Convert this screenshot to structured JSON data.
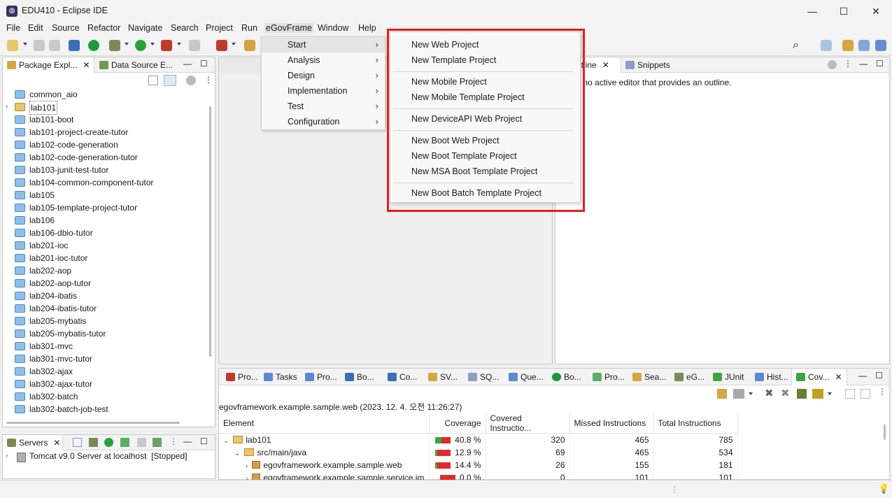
{
  "window": {
    "title": "EDU410 - Eclipse IDE",
    "minimize_icon": "minimize-icon",
    "maximize_icon": "maximize-icon",
    "close_icon": "close-icon"
  },
  "menubar": [
    "File",
    "Edit",
    "Source",
    "Refactor",
    "Navigate",
    "Search",
    "Project",
    "Run",
    "eGovFrame",
    "Window",
    "Help"
  ],
  "egov_menu": {
    "items": [
      "Start",
      "Analysis",
      "Design",
      "Implementation",
      "Test",
      "Configuration"
    ],
    "chevron": "›"
  },
  "start_submenu": {
    "items": [
      "New Web Project",
      "New Template Project",
      "New Mobile Project",
      "New Mobile Template Project",
      "New DeviceAPI Web Project",
      "New Boot Web Project",
      "New Boot Template Project",
      "New MSA Boot Template Project",
      "New Boot Batch Template Project"
    ]
  },
  "left_panel": {
    "tabs": [
      "Package Expl...",
      "Data Source E..."
    ],
    "tree": [
      "common_aio",
      "lab101",
      "lab101-boot",
      "lab101-project-create-tutor",
      "lab102-code-generation",
      "lab102-code-generation-tutor",
      "lab103-junit-test-tutor",
      "lab104-common-component-tutor",
      "lab105",
      "lab105-template-project-tutor",
      "lab106",
      "lab106-dbio-tutor",
      "lab201-ioc",
      "lab201-ioc-tutor",
      "lab202-aop",
      "lab202-aop-tutor",
      "lab204-ibatis",
      "lab204-ibatis-tutor",
      "lab205-mybatis",
      "lab205-mybatis-tutor",
      "lab301-mvc",
      "lab301-mvc-tutor",
      "lab302-ajax",
      "lab302-ajax-tutor",
      "lab302-batch",
      "lab302-batch-job-test"
    ]
  },
  "servers_panel": {
    "tab": "Servers",
    "server": "Tomcat v9.0 Server at localhost",
    "status": "[Stopped]"
  },
  "outline_panel": {
    "tab_outline": "utline",
    "tab_snippets": "Snippets",
    "message": "s no active editor that provides an outline."
  },
  "bottom_panel": {
    "tabs": [
      "Pro...",
      "Tasks",
      "Pro...",
      "Bo...",
      "Co...",
      "SV...",
      "SQ...",
      "Que...",
      "Bo...",
      "Pro...",
      "Sea...",
      "eG...",
      "JUnit",
      "Hist...",
      "Cov..."
    ],
    "session": "egovframework.example.sample.web (2023. 12. 4. 오전 11:26:27)",
    "columns": [
      "Element",
      "Coverage",
      "Covered Instructio...",
      "Missed Instructions",
      "Total Instructions"
    ],
    "rows": [
      {
        "element": "lab101",
        "coverage": "40.8 %",
        "covered": "320",
        "missed": "465",
        "total": "785",
        "cov_fraction": 0.408
      },
      {
        "element": "src/main/java",
        "coverage": "12.9 %",
        "covered": "69",
        "missed": "465",
        "total": "534",
        "cov_fraction": 0.129
      },
      {
        "element": "egovframework.example.sample.web",
        "coverage": "14.4 %",
        "covered": "26",
        "missed": "155",
        "total": "181",
        "cov_fraction": 0.144
      },
      {
        "element": "egovframework.example.sample.service.im",
        "coverage": "0.0 %",
        "covered": "0",
        "missed": "101",
        "total": "101",
        "cov_fraction": 0.0
      }
    ]
  }
}
